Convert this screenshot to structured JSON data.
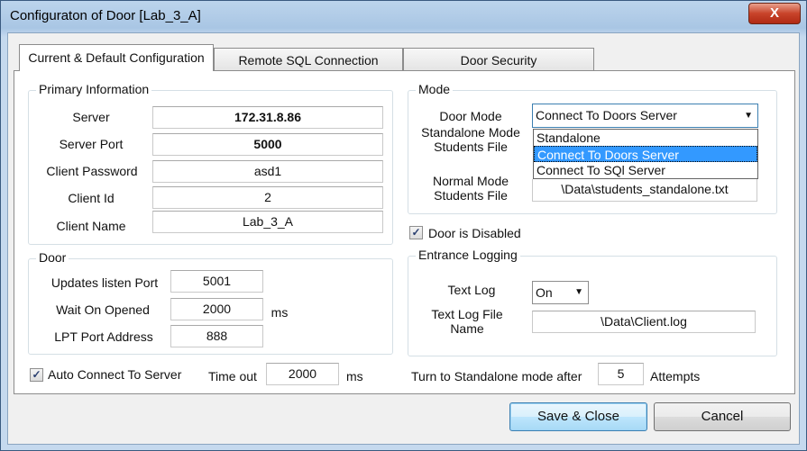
{
  "window": {
    "title": "Configuraton of Door [Lab_3_A]",
    "close_label": "X"
  },
  "tabs": [
    {
      "label": "Current & Default Configuration",
      "active": true
    },
    {
      "label": "Remote SQL Connection",
      "active": false
    },
    {
      "label": "Door Security",
      "active": false
    }
  ],
  "primary": {
    "legend": "Primary Information",
    "server_label": "Server",
    "server_value": "172.31.8.86",
    "port_label": "Server Port",
    "port_value": "5000",
    "password_label": "Client Password",
    "password_value": "asd1",
    "client_id_label": "Client Id",
    "client_id_value": "2",
    "client_name_label": "Client Name",
    "client_name_value": "Lab_3_A"
  },
  "door": {
    "legend": "Door",
    "listen_port_label": "Updates listen Port",
    "listen_port_value": "5001",
    "wait_label": "Wait On Opened",
    "wait_value": "2000",
    "wait_unit": "ms",
    "lpt_label": "LPT Port Address",
    "lpt_value": "888"
  },
  "auto_connect": {
    "checked": true,
    "check_mark": "✓",
    "label": "Auto Connect To Server",
    "timeout_label": "Time out",
    "timeout_value": "2000",
    "timeout_unit": "ms"
  },
  "mode": {
    "legend": "Mode",
    "door_mode_label": "Door Mode",
    "door_mode_value": "Connect To Doors Server",
    "dropdown_arrow": "▼",
    "options": [
      "Standalone",
      "Connect To Doors Server",
      "Connect To SQl Server"
    ],
    "standalone_file_label": "Standalone Mode Students File",
    "normal_file_label": "Normal Mode Students File",
    "normal_file_value": "\\Data\\students_standalone.txt"
  },
  "door_disabled": {
    "checked": true,
    "check_mark": "✓",
    "label": "Door is Disabled"
  },
  "logging": {
    "legend": "Entrance Logging",
    "text_log_label": "Text Log",
    "text_log_value": "On",
    "dropdown_arrow": "▼",
    "file_label": "Text Log File Name",
    "file_value": "\\Data\\Client.log"
  },
  "standalone_after": {
    "label": "Turn to Standalone mode after",
    "value": "5",
    "unit": "Attempts"
  },
  "buttons": {
    "save": "Save & Close",
    "cancel": "Cancel"
  }
}
